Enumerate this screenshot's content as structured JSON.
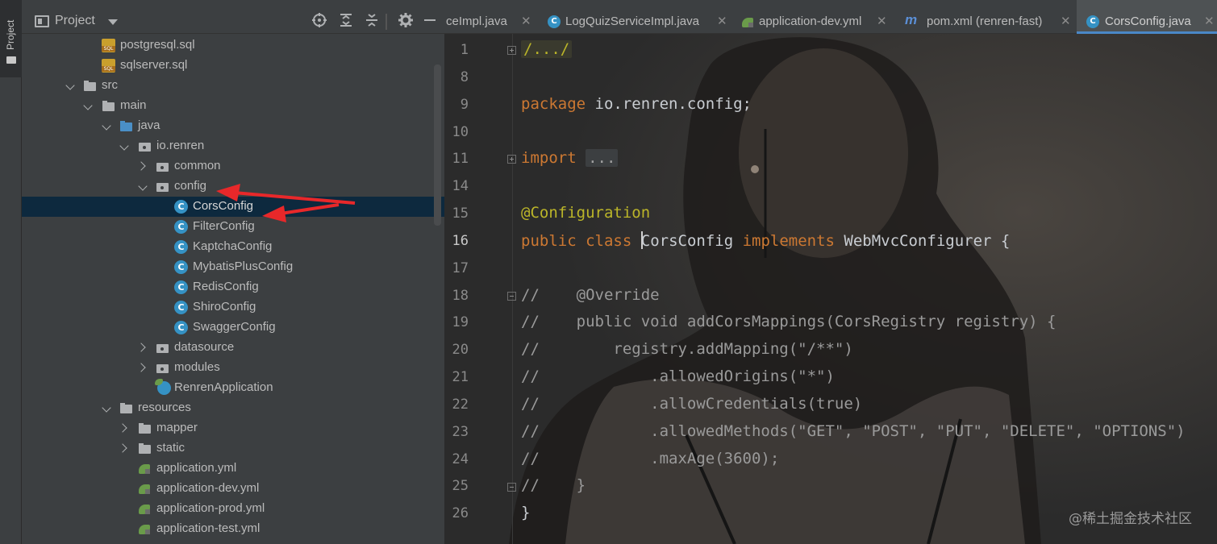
{
  "sidebar_strip": {
    "label": "Project"
  },
  "project_panel": {
    "title": "Project",
    "tree": [
      {
        "label": "postgresql.sql",
        "icon": "sql-file-icon"
      },
      {
        "label": "sqlserver.sql",
        "icon": "sql-file-icon"
      },
      {
        "label": "src",
        "icon": "folder-icon",
        "expanded": true
      },
      {
        "label": "main",
        "icon": "folder-icon",
        "expanded": true
      },
      {
        "label": "java",
        "icon": "source-folder-icon",
        "expanded": true
      },
      {
        "label": "io.renren",
        "icon": "package-icon",
        "expanded": true
      },
      {
        "label": "common",
        "icon": "package-icon",
        "expanded": false
      },
      {
        "label": "config",
        "icon": "package-icon",
        "expanded": true
      },
      {
        "label": "CorsConfig",
        "icon": "class-icon",
        "selected": true
      },
      {
        "label": "FilterConfig",
        "icon": "class-icon"
      },
      {
        "label": "KaptchaConfig",
        "icon": "class-icon"
      },
      {
        "label": "MybatisPlusConfig",
        "icon": "class-icon"
      },
      {
        "label": "RedisConfig",
        "icon": "class-icon"
      },
      {
        "label": "ShiroConfig",
        "icon": "class-icon"
      },
      {
        "label": "SwaggerConfig",
        "icon": "class-icon"
      },
      {
        "label": "datasource",
        "icon": "package-icon",
        "expanded": false
      },
      {
        "label": "modules",
        "icon": "package-icon",
        "expanded": false
      },
      {
        "label": "RenrenApplication",
        "icon": "spring-app-icon"
      },
      {
        "label": "resources",
        "icon": "resources-folder-icon",
        "expanded": true
      },
      {
        "label": "mapper",
        "icon": "folder-icon",
        "expanded": false
      },
      {
        "label": "static",
        "icon": "folder-icon",
        "expanded": false
      },
      {
        "label": "application.yml",
        "icon": "yml-file-icon"
      },
      {
        "label": "application-dev.yml",
        "icon": "yml-file-icon"
      },
      {
        "label": "application-prod.yml",
        "icon": "yml-file-icon"
      },
      {
        "label": "application-test.yml",
        "icon": "yml-file-icon"
      }
    ]
  },
  "tabs": [
    {
      "label": "ceImpl.java",
      "icon": "class-icon",
      "active": false
    },
    {
      "label": "LogQuizServiceImpl.java",
      "icon": "class-icon",
      "active": false
    },
    {
      "label": "application-dev.yml",
      "icon": "yml-file-icon",
      "active": false
    },
    {
      "label": "pom.xml (renren-fast)",
      "icon": "maven-icon",
      "active": false
    },
    {
      "label": "CorsConfig.java",
      "icon": "class-icon",
      "active": true
    }
  ],
  "editor": {
    "current_line": "16",
    "line_numbers": [
      "1",
      "8",
      "9",
      "10",
      "11",
      "14",
      "15",
      "16",
      "17",
      "18",
      "19",
      "20",
      "21",
      "22",
      "23",
      "24",
      "25",
      "26"
    ],
    "lines": {
      "l1": "/.../",
      "l9_kw": "package",
      "l9_rest": " io.renren.config;",
      "l11_kw": "import",
      "l11_fold": "...",
      "l15": "@Configuration",
      "l16_kw1": "public class",
      "l16_cls_a": "C",
      "l16_cls_b": "orsConfig",
      "l16_kw2": "implements",
      "l16_rest": " WebMvcConfigurer {",
      "l18": "//    @Override",
      "l19": "//    public void addCorsMappings(CorsRegistry registry) {",
      "l20": "//        registry.addMapping(\"/**\")",
      "l21": "//            .allowedOrigins(\"*\")",
      "l22": "//            .allowCredentials(true)",
      "l23": "//            .allowedMethods(\"GET\", \"POST\", \"PUT\", \"DELETE\", \"OPTIONS\")",
      "l24": "//            .maxAge(3600);",
      "l25": "//    }",
      "l26": "}"
    }
  },
  "watermark": "@稀土掘金技术社区",
  "colors": {
    "keyword": "#cc7832",
    "annotation": "#bbb529",
    "comment": "#9a9a9a",
    "selection": "#0d293e",
    "arrow": "#e8282a"
  }
}
